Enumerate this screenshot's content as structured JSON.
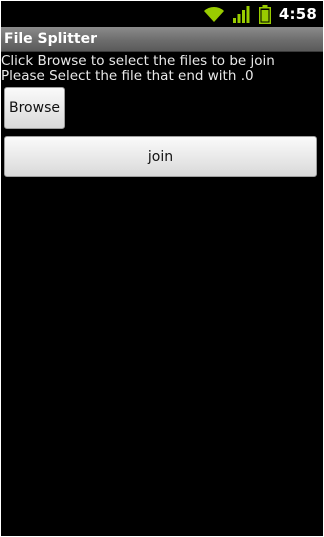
{
  "status_bar": {
    "time": "4:58",
    "icons": [
      "wifi-icon",
      "signal-icon",
      "battery-icon"
    ],
    "accent_color": "#99cc00"
  },
  "app": {
    "title": "File Splitter"
  },
  "instructions": {
    "line1": "Click Browse to select the files to be join",
    "line2": "Please Select the file that end with .0"
  },
  "buttons": {
    "browse_label": "Browse",
    "join_label": "join"
  }
}
